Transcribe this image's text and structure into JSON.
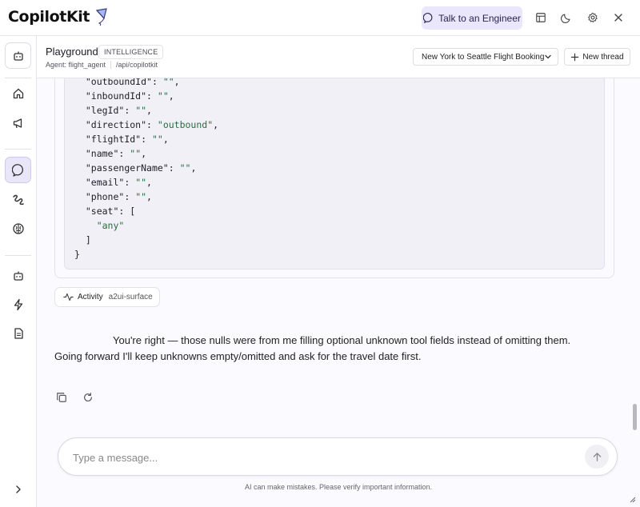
{
  "brand": {
    "name": "CopilotKit"
  },
  "topbar": {
    "talk_label": "Talk to an Engineer",
    "icons": [
      "layout-icon",
      "moon-icon",
      "gear-icon",
      "close-icon"
    ]
  },
  "subheader": {
    "title": "Playground",
    "badge": "INTELLIGENCE",
    "agent": "Agent: flight_agent",
    "endpoint": "/api/copilotkit",
    "thread": "New York to Seattle Flight Booking",
    "new_thread_label": "New thread"
  },
  "sidebar": {
    "items": [
      "bot-icon",
      "home-icon",
      "megaphone-icon",
      "chat-icon",
      "squiggle-icon",
      "brain-icon",
      "bot-icon",
      "lightning-icon",
      "document-icon",
      "chevron-right-icon"
    ],
    "active": "chat-icon"
  },
  "code": {
    "lines": [
      {
        "key": "\"outboundId\"",
        "val": "\"\"",
        "trail": ","
      },
      {
        "key": "\"inboundId\"",
        "val": "\"\"",
        "trail": ","
      },
      {
        "key": "\"legId\"",
        "val": "\"\"",
        "trail": ","
      },
      {
        "key": "\"direction\"",
        "val": "\"outbound\"",
        "trail": ","
      },
      {
        "key": "\"flightId\"",
        "val": "\"\"",
        "trail": ","
      },
      {
        "key": "\"name\"",
        "val": "\"\"",
        "trail": ","
      },
      {
        "key": "\"passengerName\"",
        "val": "\"\"",
        "trail": ","
      },
      {
        "key": "\"email\"",
        "val": "\"\"",
        "trail": ","
      },
      {
        "key": "\"phone\"",
        "val": "\"\"",
        "trail": ","
      },
      {
        "key": "\"seat\"",
        "val": "[",
        "trail": ""
      }
    ],
    "seat_value": "\"any\"",
    "close_array": "]",
    "close_obj": "}"
  },
  "activity": {
    "label": "Activity",
    "sub": "a2ui-surface"
  },
  "reply": {
    "text": "You're right — those nulls were from me filling optional unknown tool fields instead of omitting them. Going forward I'll keep unknowns empty/omitted and ask for the travel date first."
  },
  "composer": {
    "placeholder": "Type a message..."
  },
  "disclaimer": "AI can make mistakes. Please verify important information."
}
